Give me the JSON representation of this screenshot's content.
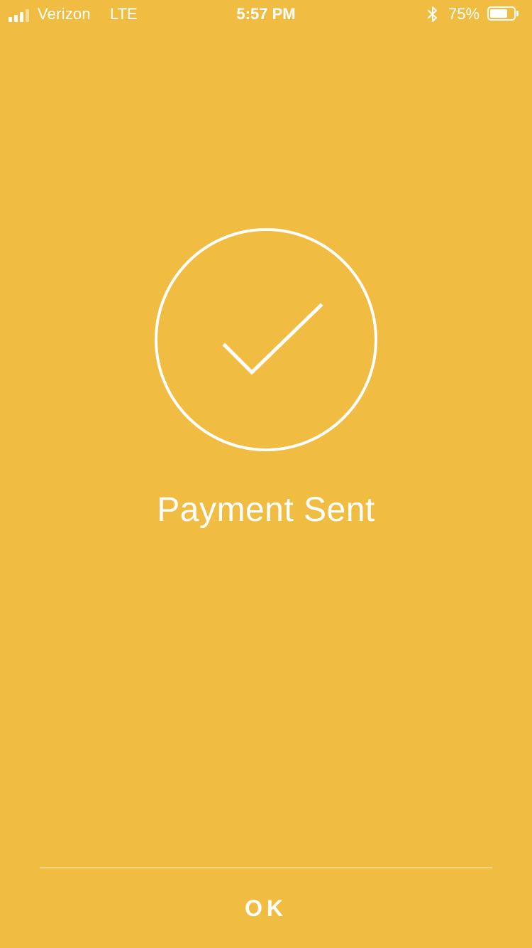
{
  "status_bar": {
    "carrier": "Verizon",
    "network": "LTE",
    "time": "5:57 PM",
    "battery_percent": "75%",
    "battery_level": 0.75,
    "icons": [
      "signal-icon",
      "bluetooth-icon",
      "battery-icon"
    ]
  },
  "confirmation": {
    "icon": "check-circle-icon",
    "title": "Payment Sent"
  },
  "footer": {
    "ok_label": "OK"
  },
  "colors": {
    "background": "#F0BD42",
    "foreground": "#FFFFFF"
  }
}
